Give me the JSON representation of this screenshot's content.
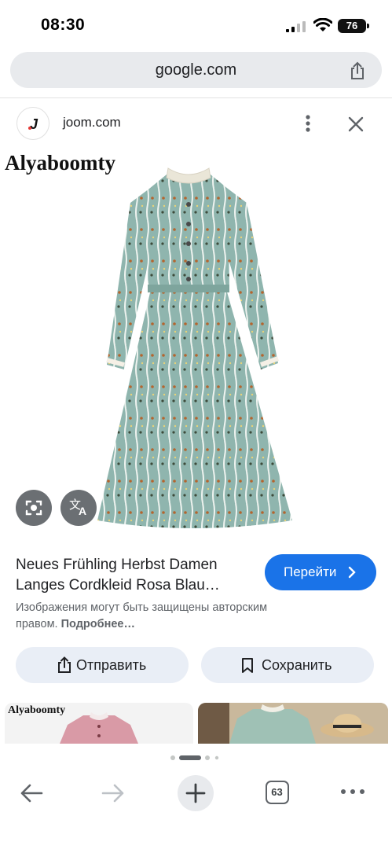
{
  "status_bar": {
    "time": "08:30",
    "battery": "76"
  },
  "address_bar": {
    "url": "google.com"
  },
  "source": {
    "domain": "joom.com",
    "favicon_letter": "J"
  },
  "image": {
    "brand_text": "Alyaboomty"
  },
  "result": {
    "title": "Neues Frühling Herbst Damen Langes Cordkleid Rosa Blau…",
    "go_label": "Перейти",
    "copyright_text": "Изображения могут быть защищены авторским правом.",
    "copyright_more": "Подробнее…"
  },
  "actions": {
    "send_label": "Отправить",
    "save_label": "Сохранить"
  },
  "related": {
    "item1_text": "Alyaboomty"
  },
  "bottom_nav": {
    "tabs_count": "63"
  },
  "colors": {
    "accent": "#1a73e8",
    "pill_bg": "#e9eef6",
    "dress_base": "#8fb5ae"
  },
  "icons": [
    "share-icon",
    "more-icon",
    "close-icon",
    "lens-icon",
    "translate-icon",
    "chevron-right-icon",
    "back-icon",
    "forward-icon",
    "plus-icon",
    "menu-icon",
    "bookmark-icon"
  ]
}
